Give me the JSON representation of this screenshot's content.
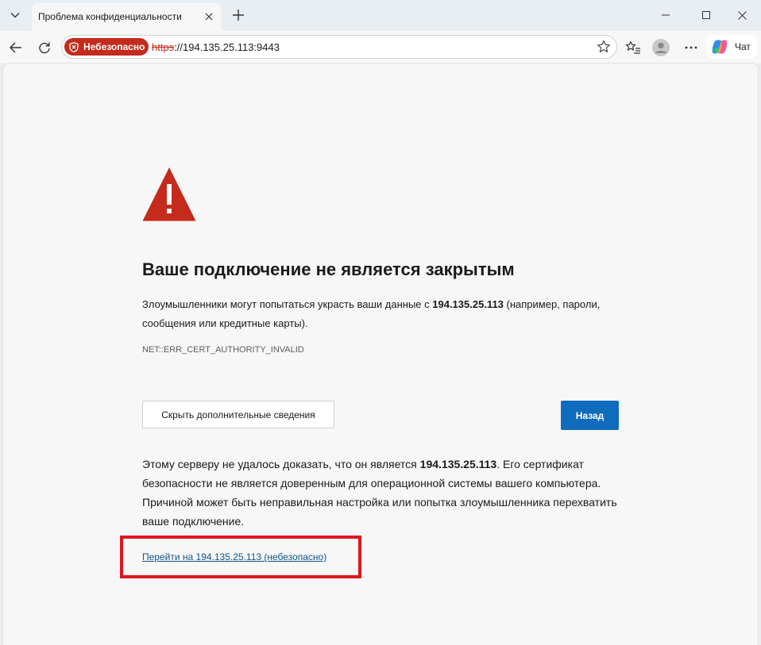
{
  "tab": {
    "title": "Проблема конфиденциальности"
  },
  "toolbar": {
    "security_badge": "Небезопасно",
    "url_scheme": "https",
    "url_rest": "://194.135.25.113:9443",
    "chat_label": "Чат"
  },
  "page": {
    "headline": "Ваше подключение не является закрытым",
    "desc_before": "Злоумышленники могут попытаться украсть ваши данные с ",
    "desc_host": "194.135.25.113",
    "desc_after": " (например, пароли, сообщения или кредитные карты).",
    "error_code": "NET::ERR_CERT_AUTHORITY_INVALID",
    "details_button": "Скрыть дополнительные сведения",
    "back_button": "Назад",
    "explain_before": "Этому серверу не удалось доказать, что он является ",
    "explain_host": "194.135.25.113",
    "explain_after": ". Его сертификат безопасности не является доверенным для операционной системы вашего компьютера. Причиной может быть неправильная настройка или попытка злоумышленника перехватить ваше подключение.",
    "proceed_link": "Перейти на 194.135.25.113 (небезопасно)"
  },
  "colors": {
    "danger": "#c42b1c",
    "primary": "#0f6cbd",
    "highlight": "#e0161e"
  },
  "icons": {
    "warning": "warning-triangle-icon",
    "shield": "shield-icon"
  }
}
